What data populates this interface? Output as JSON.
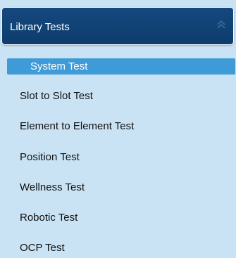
{
  "panel": {
    "title": "Library Tests",
    "collapse_icon": "double-chevron-up-icon",
    "items": [
      {
        "label": "System Test",
        "selected": true
      },
      {
        "label": "Slot to Slot Test",
        "selected": false
      },
      {
        "label": "Element to Element Test",
        "selected": false
      },
      {
        "label": "Position Test",
        "selected": false
      },
      {
        "label": "Wellness Test",
        "selected": false
      },
      {
        "label": "Robotic Test",
        "selected": false
      },
      {
        "label": "OCP Test",
        "selected": false
      }
    ]
  },
  "colors": {
    "background": "#c9e3f5",
    "header": "#0d3d6d",
    "selected": "#3f9bd7"
  }
}
